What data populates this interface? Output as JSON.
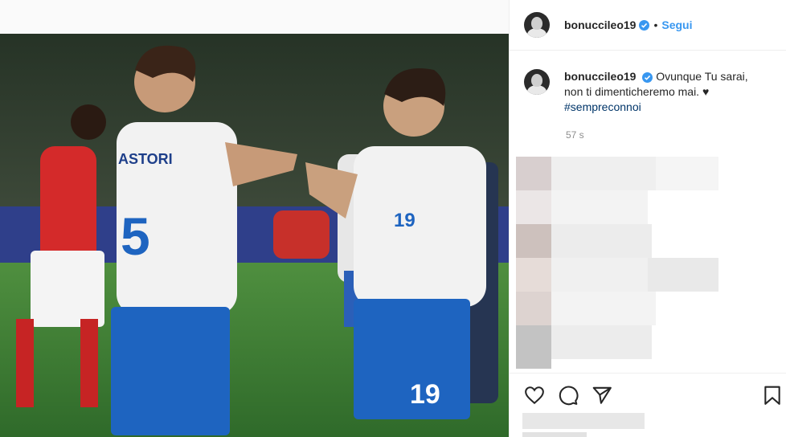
{
  "post": {
    "username": "bonuccileo19",
    "follow_label": "Segui",
    "separator": "•"
  },
  "caption": {
    "username": "bonuccileo19",
    "text": "Ovunque Tu sarai, non ti dimenticheremo mai. ♥",
    "hashtag": "#sempreconnoi",
    "time": "57 s"
  },
  "photo": {
    "left_player_name": "ASTORI",
    "left_player_number": "5",
    "right_player_number": "19"
  },
  "icons": [
    "heart-icon",
    "comment-icon",
    "share-icon",
    "bookmark-icon",
    "verified-icon"
  ],
  "colors": {
    "accent": "#3897f0",
    "verified": "#3897f0",
    "jersey_white": "#f2f2f2",
    "shorts_blue": "#1e64c0"
  }
}
